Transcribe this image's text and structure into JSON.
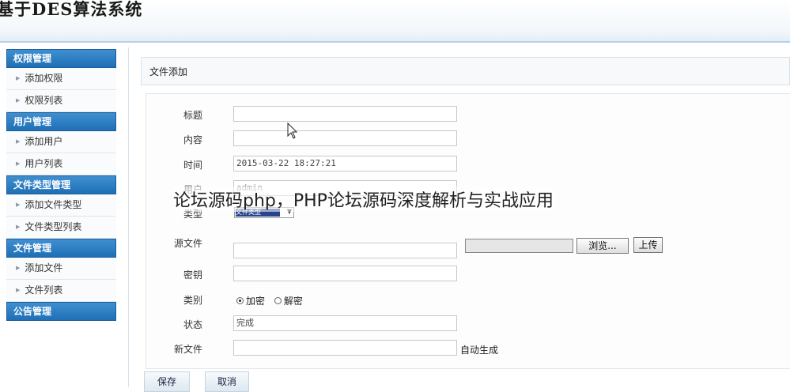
{
  "app": {
    "title": "基于DES算法系统"
  },
  "sidebar": {
    "groups": [
      {
        "title": "权限管理",
        "items": [
          "添加权限",
          "权限列表"
        ]
      },
      {
        "title": "用户管理",
        "items": [
          "添加用户",
          "用户列表"
        ]
      },
      {
        "title": "文件类型管理",
        "items": [
          "添加文件类型",
          "文件类型列表"
        ]
      },
      {
        "title": "文件管理",
        "items": [
          "添加文件",
          "文件列表"
        ]
      },
      {
        "title": "公告管理",
        "items": []
      }
    ]
  },
  "breadcrumb": "文件添加",
  "form": {
    "title_label": "标题",
    "title_value": "",
    "content_label": "内容",
    "content_value": "",
    "time_label": "时间",
    "time_value": "2015-03-22 18:27:21",
    "user_label": "用户",
    "user_value": "admin",
    "type_label": "类型",
    "type_value": "文件类型",
    "source_label": "源文件",
    "source_value": "",
    "browse_label": "浏览...",
    "upload_label": "上传",
    "key_label": "密钥",
    "key_value": "",
    "category_label": "类别",
    "category_options": [
      {
        "label": "加密",
        "selected": true
      },
      {
        "label": "解密",
        "selected": false
      }
    ],
    "status_label": "状态",
    "status_value": "完成",
    "newfile_label": "新文件",
    "newfile_value": "",
    "newfile_note": "自动生成"
  },
  "actions": {
    "save": "保存",
    "cancel": "取消"
  },
  "overlay_text": "论坛源码php，PHP论坛源码深度解析与实战应用"
}
